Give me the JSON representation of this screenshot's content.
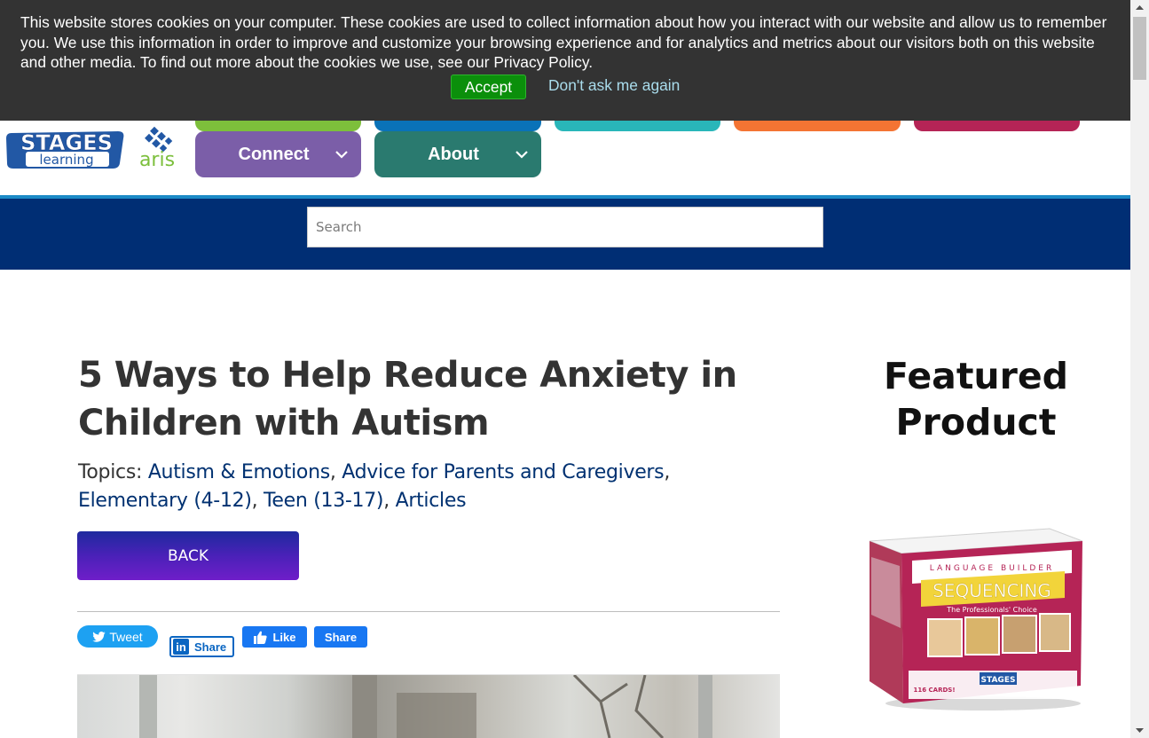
{
  "cookie_banner": {
    "text": "This website stores cookies on your computer. These cookies are used to collect information about how you interact with our website and allow us to remember you. We use this information in order to improve and customize your browsing experience and for analytics and metrics about our visitors both on this website and other media. To find out more about the cookies we use, see our Privacy Policy.",
    "accept_label": "Accept",
    "dont_ask_label": "Don't ask me again"
  },
  "header": {
    "logo_primary": "STAGES",
    "logo_secondary": "learning",
    "logo_partner": "aris",
    "nav": [
      {
        "label": "Connect",
        "color": "#7b5ea8"
      },
      {
        "label": "About",
        "color": "#2a7a6f"
      }
    ],
    "top_strip_colors": [
      "#7dbf3b",
      "#0a72b8",
      "#29b6b9",
      "#f47433",
      "#b52456"
    ]
  },
  "search": {
    "placeholder": "Search"
  },
  "article": {
    "title": "5 Ways to Help Reduce Anxiety in Children with Autism",
    "topics_prefix": "Topics: ",
    "topics": [
      "Autism & Emotions",
      "Advice for Parents and Caregivers",
      "Elementary (4-12)",
      "Teen (13-17)",
      "Articles"
    ],
    "back_label": "BACK"
  },
  "share": {
    "tweet_label": "Tweet",
    "linkedin_label": "Share",
    "linkedin_glyph": "in",
    "fb_like_label": "Like",
    "fb_share_label": "Share"
  },
  "sidebar": {
    "featured_title": "Featured Product",
    "product": {
      "brand_line": "LANGUAGE BUILDER",
      "name": "SEQUENCING",
      "tagline": "The Professionals' Choice",
      "cards": "116 CARDS!",
      "publisher": "STAGES"
    }
  },
  "colors": {
    "search_band": "#002e74",
    "link": "#003171",
    "cookie_bg": "#333333",
    "accept_green": "#0b8f0b"
  }
}
